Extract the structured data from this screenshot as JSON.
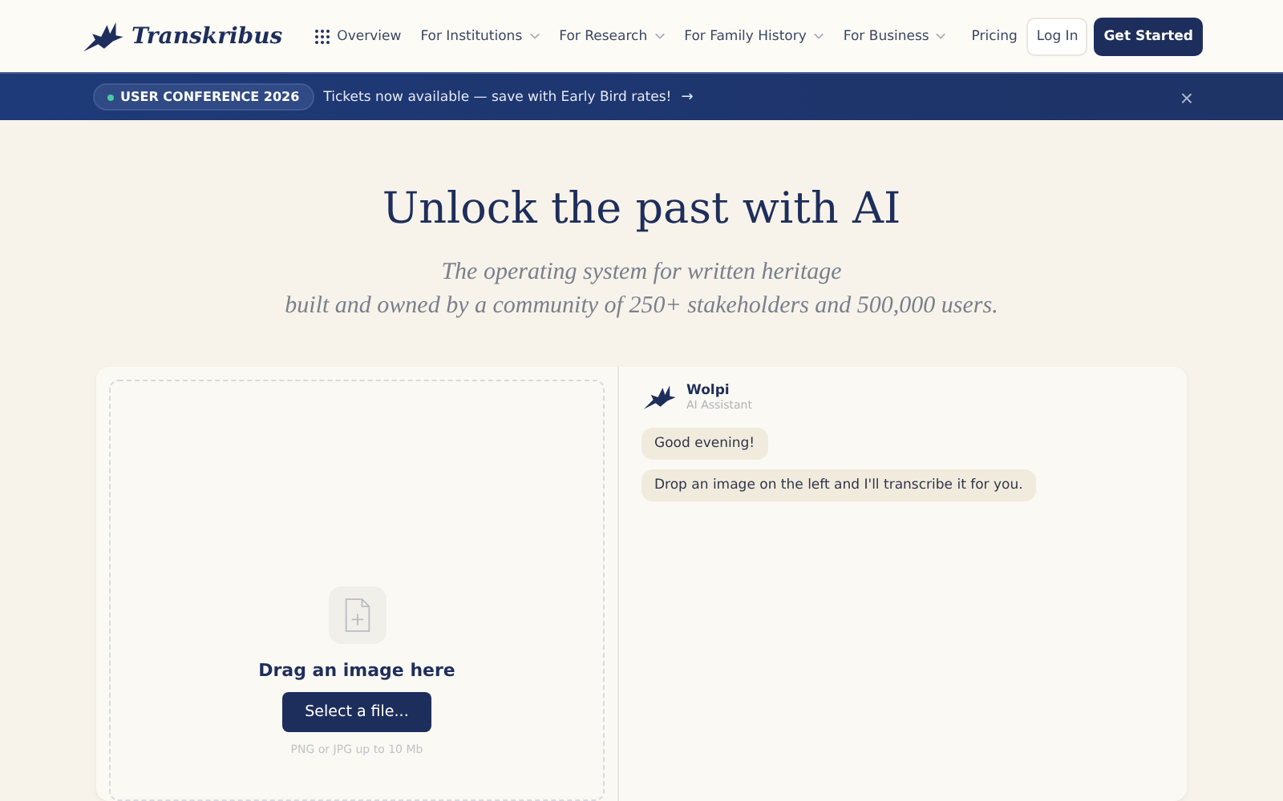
{
  "header": {
    "logo": "Transkribus",
    "nav": [
      {
        "label": "Overview",
        "kind": "grid"
      },
      {
        "label": "For Institutions",
        "kind": "menu"
      },
      {
        "label": "For Research",
        "kind": "menu"
      },
      {
        "label": "For Family History",
        "kind": "menu"
      },
      {
        "label": "For Business",
        "kind": "menu"
      }
    ],
    "actions": [
      {
        "label": "Pricing",
        "kind": "link"
      },
      {
        "label": "Log In",
        "kind": "outline"
      },
      {
        "label": "Get Started",
        "kind": "primary"
      }
    ]
  },
  "banner": {
    "badge": "USER CONFERENCE 2026",
    "message": "Tickets now available — save with Early Bird rates!",
    "arrow": "→",
    "close": "×"
  },
  "hero": {
    "title": "Unlock the past with AI",
    "subtitle_lines": [
      "The operating system for written heritage",
      "built and owned by a community of 250+ stakeholders and 500,000 users."
    ]
  },
  "upload": {
    "title": "Drag an image here",
    "button": "Select a file...",
    "hint": "PNG or JPG up to 10 Mb"
  },
  "chat": {
    "name": "Wolpi",
    "role": "AI Assistant",
    "messages": [
      "Good evening!",
      "Drop an image on the left and I'll transcribe it for you."
    ]
  }
}
